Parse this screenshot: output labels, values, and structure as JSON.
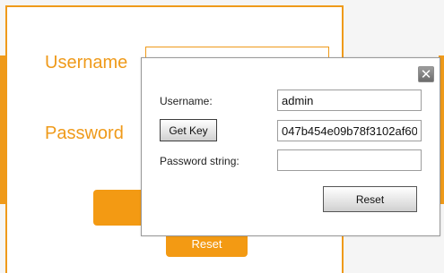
{
  "background": {
    "username_label": "Username",
    "password_label": "Password",
    "reset_label": "Reset"
  },
  "modal": {
    "close_glyph": "✕",
    "username_label": "Username:",
    "username_value": "admin",
    "get_key_label": "Get Key",
    "key_value": "047b454e09b78f3102af60",
    "password_string_label": "Password string:",
    "password_string_value": "",
    "reset_label": "Reset"
  },
  "colors": {
    "accent_orange": "#ef9a1a",
    "button_orange": "#f39a13"
  }
}
